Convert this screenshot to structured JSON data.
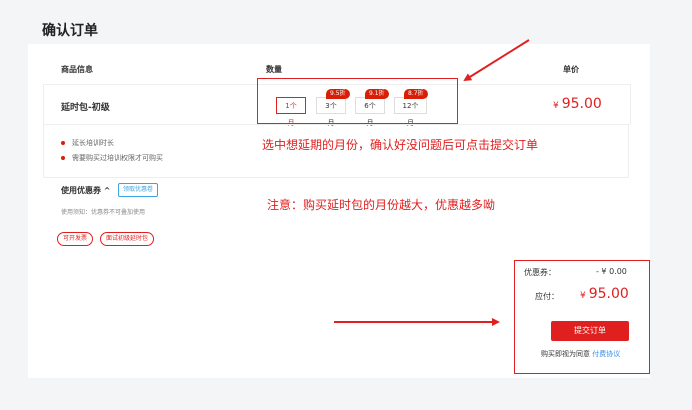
{
  "page": {
    "title": "确认订单"
  },
  "table": {
    "headers": {
      "product": "商品信息",
      "quantity": "数量",
      "unit_price": "单价"
    },
    "product_name": "延时包-初级",
    "options": [
      {
        "label": "1个月",
        "discount": "",
        "selected": true
      },
      {
        "label": "3个月",
        "discount": "9.5折",
        "selected": false
      },
      {
        "label": "6个月",
        "discount": "9.1折",
        "selected": false
      },
      {
        "label": "12个月",
        "discount": "8.7折",
        "selected": false
      }
    ],
    "price_symbol": "¥",
    "price": "95.00"
  },
  "benefits": [
    "延长培训时长",
    "需要购买过培训权限才可购买"
  ],
  "coupon": {
    "label": "使用优惠券",
    "caret": "^",
    "button": "领取优惠卷",
    "note": "使用须知：优惠券不可叠加使用"
  },
  "tags": [
    "可开发票",
    "面试初级延时包"
  ],
  "annotations": {
    "select_hint": "选中想延期的月份，确认好没问题后可点击提交订单",
    "note_hint": "注意：购买延时包的月份越大，优惠越多呦"
  },
  "summary": {
    "coupon_label": "优惠券：",
    "coupon_value": "- ¥ 0.00",
    "pay_label": "应付：",
    "pay_symbol": "¥",
    "pay_value": "95.00",
    "submit": "提交订单",
    "agree_text": "购买即视为同意",
    "agree_link": "付费协议"
  },
  "colors": {
    "accent": "#e02020",
    "link": "#3a8ee6"
  }
}
